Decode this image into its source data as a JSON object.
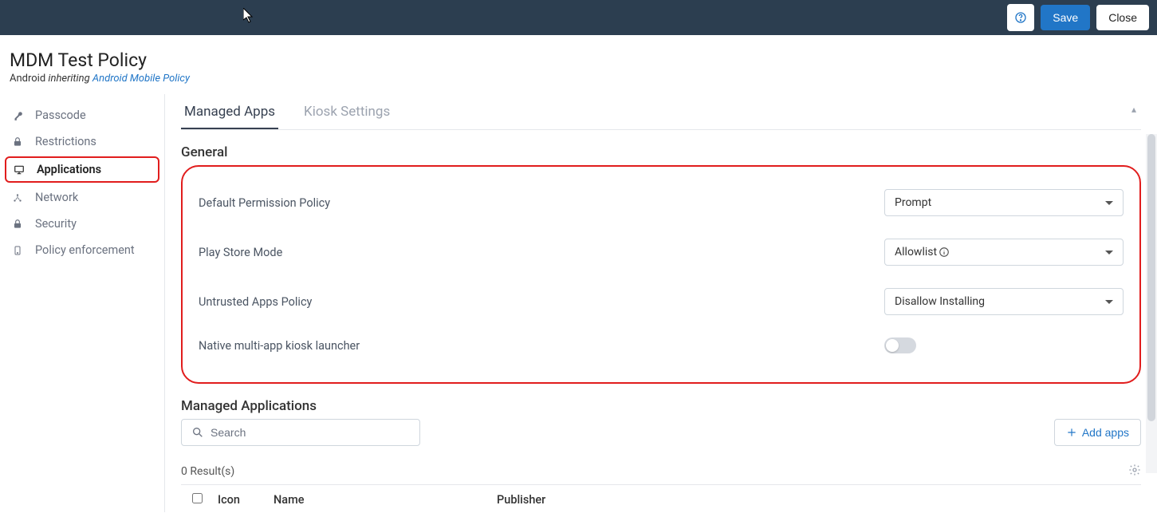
{
  "header": {
    "save_label": "Save",
    "close_label": "Close"
  },
  "page": {
    "title": "MDM Test Policy",
    "platform": "Android",
    "inheriting_label": "inheriting",
    "inherit_link": "Android Mobile Policy"
  },
  "sidebar": {
    "items": [
      {
        "label": "Passcode",
        "icon": "key"
      },
      {
        "label": "Restrictions",
        "icon": "lock"
      },
      {
        "label": "Applications",
        "icon": "monitor",
        "active": true
      },
      {
        "label": "Network",
        "icon": "network"
      },
      {
        "label": "Security",
        "icon": "lock"
      },
      {
        "label": "Policy enforcement",
        "icon": "phone"
      }
    ]
  },
  "tabs": {
    "managed_apps": "Managed Apps",
    "kiosk_settings": "Kiosk Settings"
  },
  "general": {
    "heading": "General",
    "default_permission_label": "Default Permission Policy",
    "default_permission_value": "Prompt",
    "play_store_label": "Play Store Mode",
    "play_store_value": "Allowlist",
    "untrusted_label": "Untrusted Apps Policy",
    "untrusted_value": "Disallow Installing",
    "kiosk_launcher_label": "Native multi-app kiosk launcher"
  },
  "managed_apps": {
    "heading": "Managed Applications",
    "search_placeholder": "Search",
    "add_apps_label": "Add apps",
    "results_text": "0 Result(s)",
    "columns": {
      "icon": "Icon",
      "name": "Name",
      "publisher": "Publisher"
    }
  }
}
